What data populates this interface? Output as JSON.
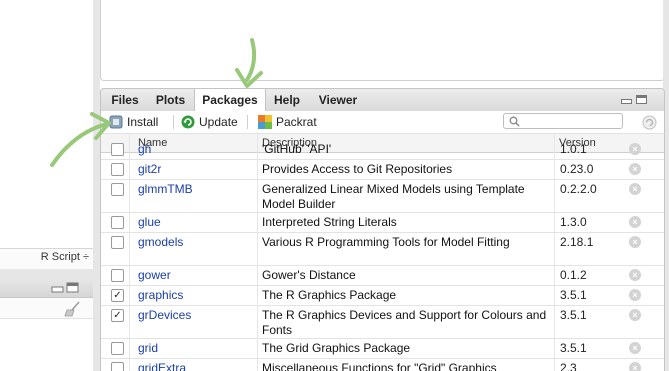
{
  "left_pane": {
    "script_type": "R Script ÷"
  },
  "tabs": [
    "Files",
    "Plots",
    "Packages",
    "Help",
    "Viewer"
  ],
  "active_tab": "Packages",
  "toolbar": {
    "install_label": "Install",
    "update_label": "Update",
    "packrat_label": "Packrat",
    "search_value": ""
  },
  "table": {
    "headers": [
      "Name",
      "Description",
      "Version"
    ],
    "rows": [
      {
        "checked": false,
        "name": "gh",
        "desc": "'GitHub' 'API'",
        "version": "1.0.1"
      },
      {
        "checked": false,
        "name": "git2r",
        "desc": "Provides Access to Git Repositories",
        "version": "0.23.0"
      },
      {
        "checked": false,
        "name": "glmmTMB",
        "desc": "Generalized Linear Mixed Models using Template Model Builder",
        "version": "0.2.2.0"
      },
      {
        "checked": false,
        "name": "glue",
        "desc": "Interpreted String Literals",
        "version": "1.3.0"
      },
      {
        "checked": false,
        "name": "gmodels",
        "desc": "Various R Programming Tools for Model Fitting",
        "version": "2.18.1"
      },
      {
        "checked": false,
        "name": "gower",
        "desc": "Gower's Distance",
        "version": "0.1.2"
      },
      {
        "checked": true,
        "name": "graphics",
        "desc": "The R Graphics Package",
        "version": "3.5.1"
      },
      {
        "checked": true,
        "name": "grDevices",
        "desc": "The R Graphics Devices and Support for Colours and Fonts",
        "version": "3.5.1"
      },
      {
        "checked": false,
        "name": "grid",
        "desc": "The Grid Graphics Package",
        "version": "3.5.1"
      },
      {
        "checked": false,
        "name": "gridExtra",
        "desc": "Miscellaneous Functions for \"Grid\" Graphics",
        "version": "2.3"
      }
    ]
  },
  "annotation_color": "#98c97a"
}
